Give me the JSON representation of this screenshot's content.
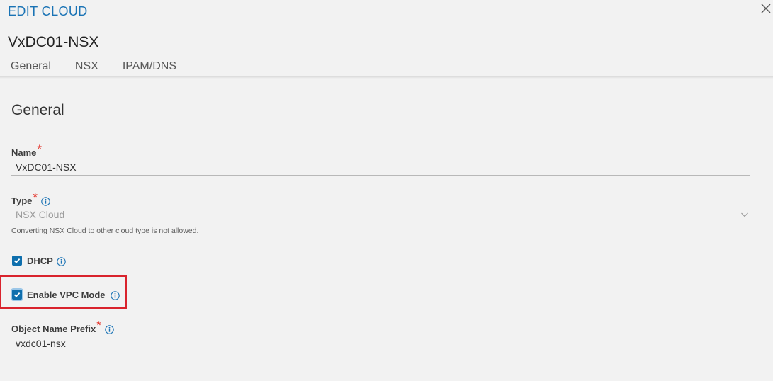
{
  "dialog": {
    "title": "EDIT CLOUD",
    "cloud_name": "VxDC01-NSX"
  },
  "tabs": [
    {
      "label": "General",
      "active": true
    },
    {
      "label": "NSX",
      "active": false
    },
    {
      "label": "IPAM/DNS",
      "active": false
    }
  ],
  "general": {
    "section_title": "General",
    "name": {
      "label": "Name",
      "required": "*",
      "value": "VxDC01-NSX"
    },
    "type": {
      "label": "Type",
      "required": "*",
      "value": "NSX Cloud",
      "helper": "Converting NSX Cloud to other cloud type is not allowed."
    },
    "dhcp": {
      "label": "DHCP",
      "checked": true
    },
    "vpc_mode": {
      "label": "Enable VPC Mode",
      "checked": true
    },
    "object_name_prefix": {
      "label": "Object Name Prefix",
      "required": "*",
      "value": "vxdc01-nsx"
    }
  },
  "colors": {
    "accent": "#1a73b5",
    "checkbox": "#0f6fad",
    "required": "#e3362d",
    "highlight": "#d9232d"
  },
  "icons": [
    "close-icon",
    "info-icon",
    "chevron-down-icon",
    "checkmark-icon"
  ]
}
